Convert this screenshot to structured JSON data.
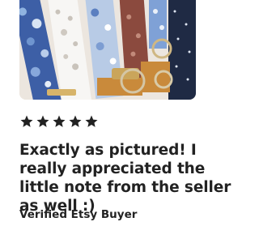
{
  "review_card": {
    "photo": {
      "icon": "product-photo-fabric-keychains"
    },
    "rating": {
      "value": 5,
      "max": 5,
      "star_color": "#222222"
    },
    "review_text": "Exactly as pictured! I really appreciated the little note from the seller as well :)",
    "reviewer_label": "Verified Etsy Buyer"
  }
}
